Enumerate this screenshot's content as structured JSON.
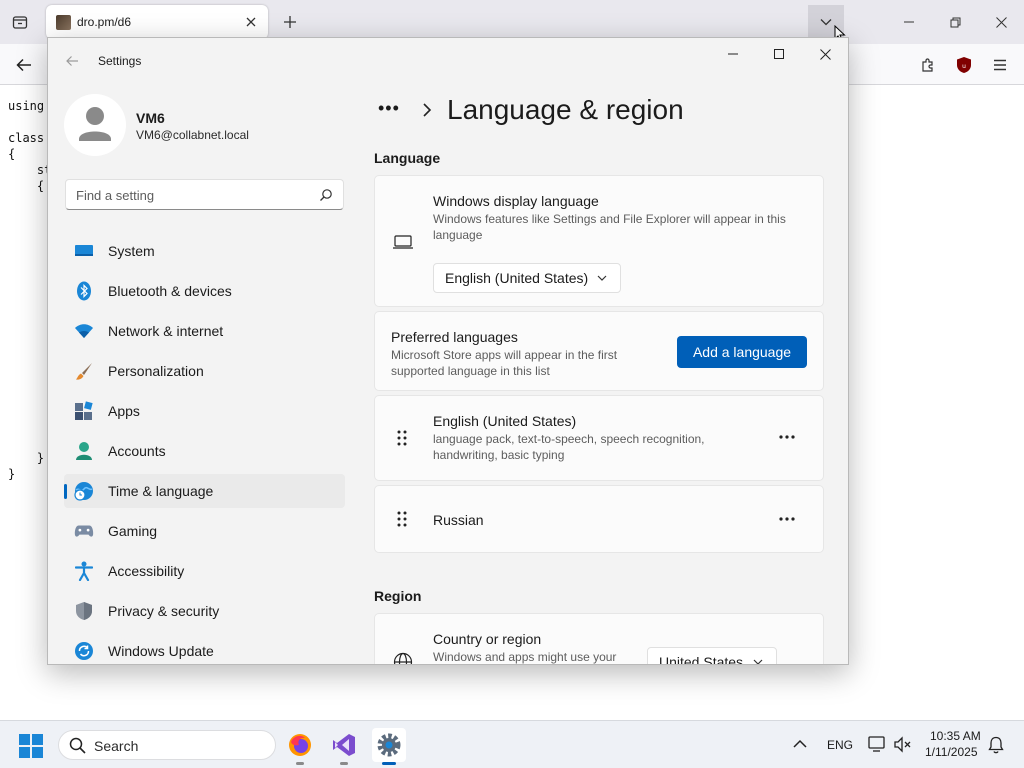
{
  "browser": {
    "tab_title": "dro.pm/d6",
    "page_code_lines": [
      "using",
      "",
      "class",
      "{",
      "    st",
      "    {",
      "",
      "",
      "",
      "",
      "",
      "",
      "",
      "",
      "",
      "",
      "",
      "",
      "",
      "",
      "",
      "",
      "    }",
      "}"
    ]
  },
  "settings": {
    "window_title": "Settings",
    "profile": {
      "name": "VM6",
      "email": "VM6@collabnet.local"
    },
    "search": {
      "placeholder": "Find a setting"
    },
    "nav": [
      {
        "label": "System",
        "icon": "system-icon"
      },
      {
        "label": "Bluetooth & devices",
        "icon": "bluetooth-icon"
      },
      {
        "label": "Network & internet",
        "icon": "wifi-icon"
      },
      {
        "label": "Personalization",
        "icon": "brush-icon"
      },
      {
        "label": "Apps",
        "icon": "apps-icon"
      },
      {
        "label": "Accounts",
        "icon": "accounts-icon"
      },
      {
        "label": "Time & language",
        "icon": "globe-clock-icon",
        "active": true
      },
      {
        "label": "Gaming",
        "icon": "gamepad-icon"
      },
      {
        "label": "Accessibility",
        "icon": "accessibility-icon"
      },
      {
        "label": "Privacy & security",
        "icon": "shield-icon"
      },
      {
        "label": "Windows Update",
        "icon": "update-icon"
      }
    ],
    "breadcrumb_more": "•••",
    "page_title": "Language & region",
    "language_section": {
      "heading": "Language",
      "display_language": {
        "title": "Windows display language",
        "description_lines": [
          "Windows features like Settings and File Explorer will appear in this",
          "language"
        ],
        "value": "English (United States)"
      },
      "preferred": {
        "title": "Preferred languages",
        "description_lines": [
          "Microsoft Store apps will appear in the first",
          "supported language in this list"
        ],
        "add_button": "Add a language"
      },
      "languages": [
        {
          "name": "English (United States)",
          "detail_lines": [
            "language pack, text-to-speech, speech recognition,",
            "handwriting, basic typing"
          ]
        },
        {
          "name": "Russian",
          "detail_lines": []
        }
      ]
    },
    "region_section": {
      "heading": "Region",
      "country": {
        "title": "Country or region",
        "description": "Windows and apps might use your",
        "value": "United States"
      }
    }
  },
  "taskbar": {
    "search_label": "Search",
    "language": "ENG",
    "time": "10:35 AM",
    "date": "1/11/2025"
  },
  "colors": {
    "accent": "#005fb8",
    "nav_indicator": "#0067c0"
  }
}
